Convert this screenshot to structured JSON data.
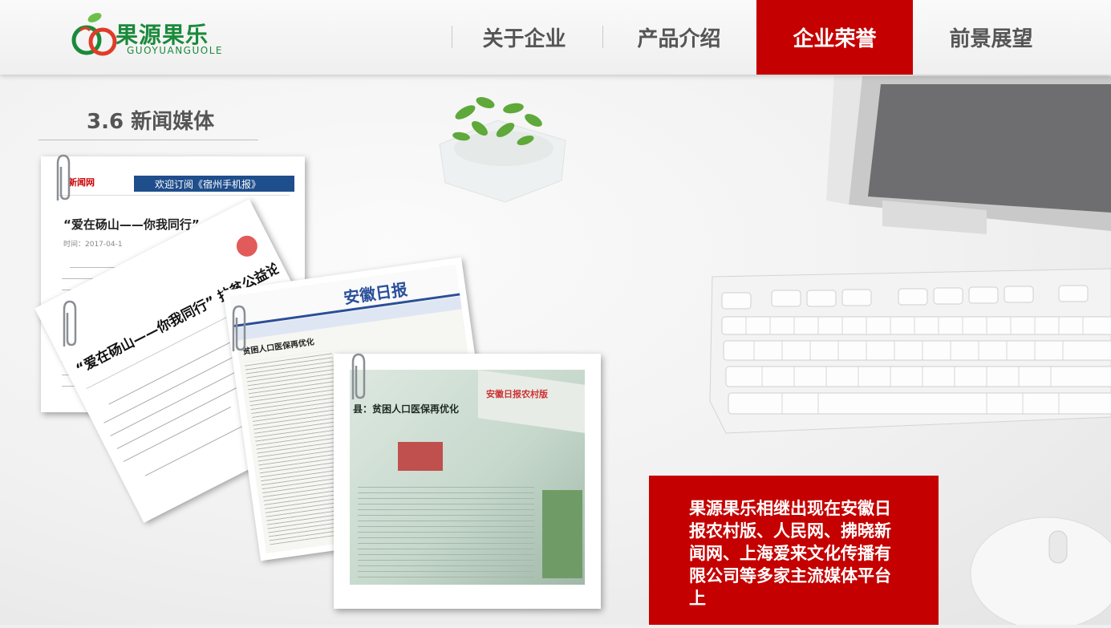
{
  "logo": {
    "name": "果源果乐",
    "name_en": "GUOYUANGUOLE",
    "brand_color": "#1a8a3a",
    "accent_color": "#e03c28"
  },
  "nav": {
    "items": [
      {
        "label": "关于企业",
        "active": false
      },
      {
        "label": "产品介绍",
        "active": false
      },
      {
        "label": "企业荣誉",
        "active": true
      },
      {
        "label": "前景展望",
        "active": false
      }
    ],
    "active_color": "#c50000"
  },
  "section": {
    "title": "3.6 新闻媒体"
  },
  "cards": {
    "card1": {
      "site_label": "新闻网",
      "banner": "欢迎订阅《宿州手机报》",
      "headline": "“爱在砀山——你我同行”",
      "meta": "时间：2017-04-1"
    },
    "card2": {
      "headline": "“爱在砀山——你我同行” 扶贫公益论坛举办"
    },
    "card3": {
      "masthead": "安徽日报",
      "subhead": "贫困人口医保再优化"
    },
    "card4": {
      "headline": "县：贫困人口医保再优化",
      "masthead": "安徽日报农村版"
    }
  },
  "caption": {
    "text": "果源果乐相继出现在安徽日报农村版、人民网、拂晓新闻网、上海爱来文化传播有限公司等多家主流媒体平台上"
  }
}
